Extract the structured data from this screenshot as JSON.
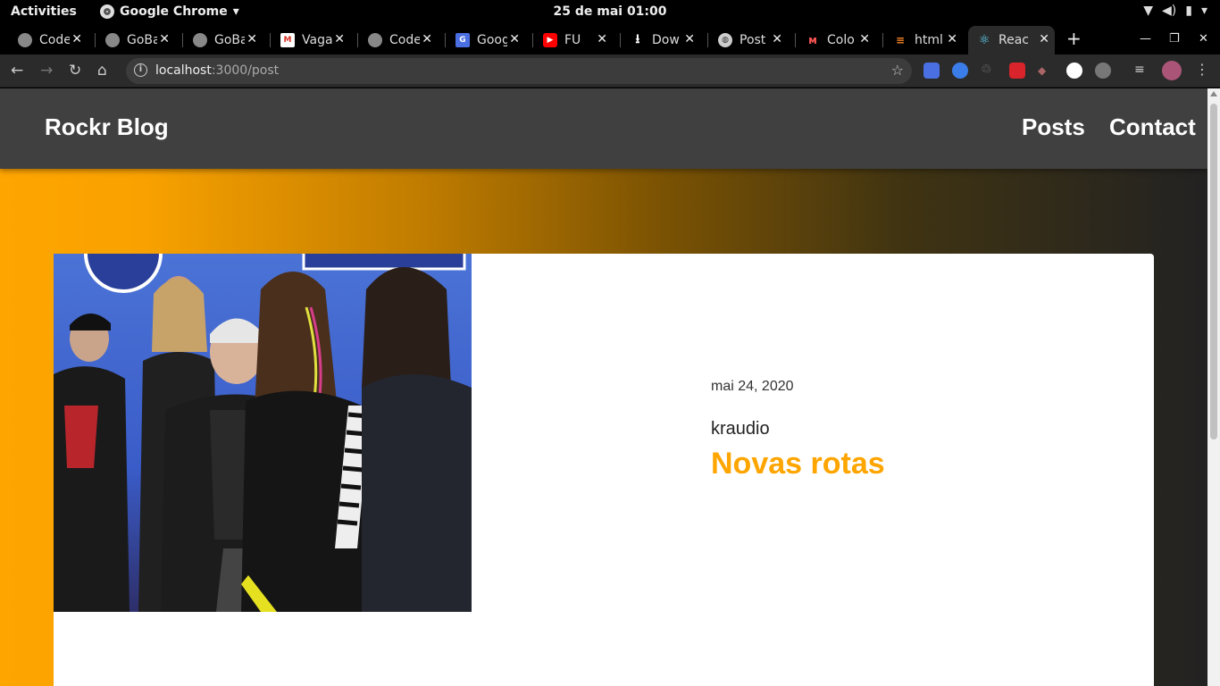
{
  "system": {
    "activities": "Activities",
    "app_name": "Google Chrome",
    "clock": "25 de mai  01:00"
  },
  "browser": {
    "tabs": [
      {
        "title": "Code",
        "icon": "github-icon"
      },
      {
        "title": "GoBa",
        "icon": "github-icon"
      },
      {
        "title": "GoBa",
        "icon": "github-icon"
      },
      {
        "title": "Vaga",
        "icon": "gmail-icon"
      },
      {
        "title": "Code",
        "icon": "github-icon"
      },
      {
        "title": "Goog",
        "icon": "google-translate-icon"
      },
      {
        "title": "FU",
        "icon": "youtube-icon"
      },
      {
        "title": "Dow",
        "icon": "download-icon"
      },
      {
        "title": "Post",
        "icon": "globe-icon"
      },
      {
        "title": "Colo",
        "icon": "color-icon"
      },
      {
        "title": "html",
        "icon": "stackoverflow-icon"
      },
      {
        "title": "Reac",
        "icon": "react-icon",
        "active": true
      }
    ],
    "url_host": "localhost",
    "url_path": ":3000/post"
  },
  "site": {
    "brand": "Rockr Blog",
    "nav": {
      "posts": "Posts",
      "contact": "Contact"
    },
    "accent_color": "#ffa500",
    "header_color": "#404040"
  },
  "post": {
    "date": "mai 24, 2020",
    "author": "kraudio",
    "title": "Novas rotas"
  }
}
